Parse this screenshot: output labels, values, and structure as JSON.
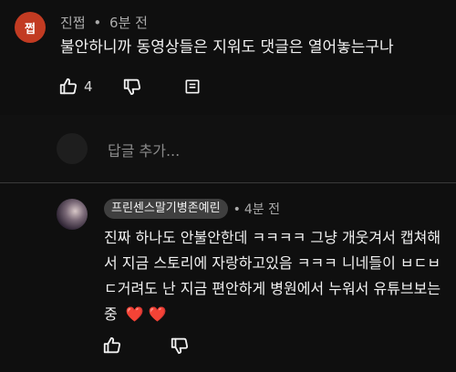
{
  "top_comment": {
    "avatar_text": "쩝",
    "author": "진쩝",
    "separator": "•",
    "time": "6분 전",
    "text": "불안하니까 동영상들은 지워도 댓글은 열어놓는구나",
    "like_count": "4"
  },
  "add_comment": {
    "placeholder": "답글 추가..."
  },
  "reply": {
    "channel": "프린센스말기병존예린",
    "separator": "•",
    "time": "4분 전",
    "text": "진짜 하나도 안불안한데 ㅋㅋㅋㅋ 그냥 개웃겨서 캡쳐해서 지금 스토리에 자랑하고있음 ㅋㅋㅋ 니네들이 ㅂㄷㅂㄷ거려도 난 지금 편안하게 병원에서 누워서 유튜브보는중",
    "emoji": "❤️ ❤️"
  },
  "icons": {
    "like": "thumbs-up-icon",
    "dislike": "thumbs-down-icon",
    "reply": "reply-comment-icon"
  },
  "colors": {
    "background": "#0f0f0f",
    "avatar_red": "#c23b22",
    "chip_bg": "#3f3f3f",
    "heart": "#e53935"
  }
}
